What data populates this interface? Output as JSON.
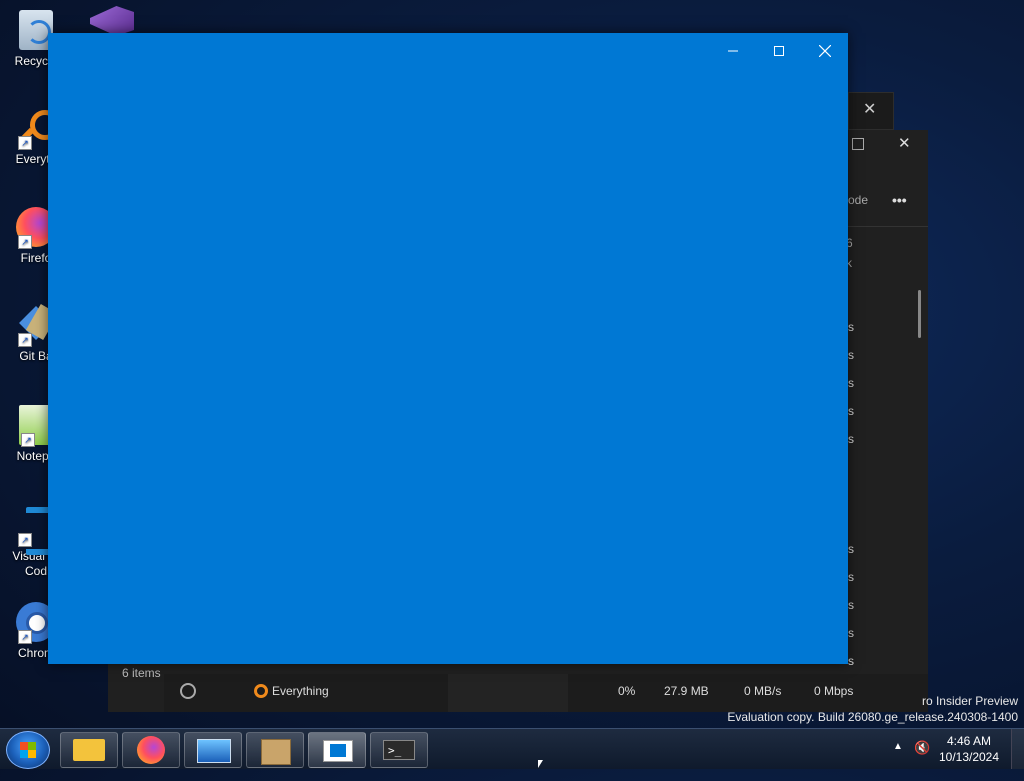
{
  "desktop": {
    "icons": [
      {
        "label": "Recycle",
        "icon": "recycle-bin-icon"
      },
      {
        "label": "Everyth",
        "icon": "everything-search-icon"
      },
      {
        "label": "Firefo",
        "icon": "firefox-icon"
      },
      {
        "label": "Git Ba",
        "icon": "git-bash-icon"
      },
      {
        "label": "Notepa",
        "icon": "notepad-plus-icon"
      },
      {
        "label": "Visual St\nCod",
        "icon": "vscode-icon"
      },
      {
        "label": "Chrom",
        "icon": "chrome-icon"
      }
    ]
  },
  "background_window": {
    "toolbar_partial_text": "ode",
    "more_label": "•••",
    "status_bar": {
      "items": "6 items"
    },
    "column_partial": [
      "6",
      "k"
    ],
    "rows_suffix": [
      "s",
      "s",
      "s",
      "s",
      "s",
      "s",
      "s",
      "s",
      "s",
      "s"
    ],
    "process_row": {
      "name": "Everything",
      "cpu": "0%",
      "memory": "27.9 MB",
      "disk": "0 MB/s",
      "network": "0 Mbps"
    }
  },
  "blue_window": {
    "controls": {
      "minimize": "minimize",
      "maximize": "maximize",
      "close": "close"
    }
  },
  "watermark": {
    "line1": "ro Insider Preview",
    "line2": "Evaluation copy. Build 26080.ge_release.240308-1400"
  },
  "taskbar": {
    "buttons": [
      "file-explorer",
      "firefox",
      "resource-monitor",
      "package-store",
      "app-window",
      "terminal"
    ],
    "clock": {
      "time": "4:46 AM",
      "date": "10/13/2024"
    }
  },
  "colors": {
    "window_blue": "#0078d4",
    "dark_window": "#202020"
  }
}
